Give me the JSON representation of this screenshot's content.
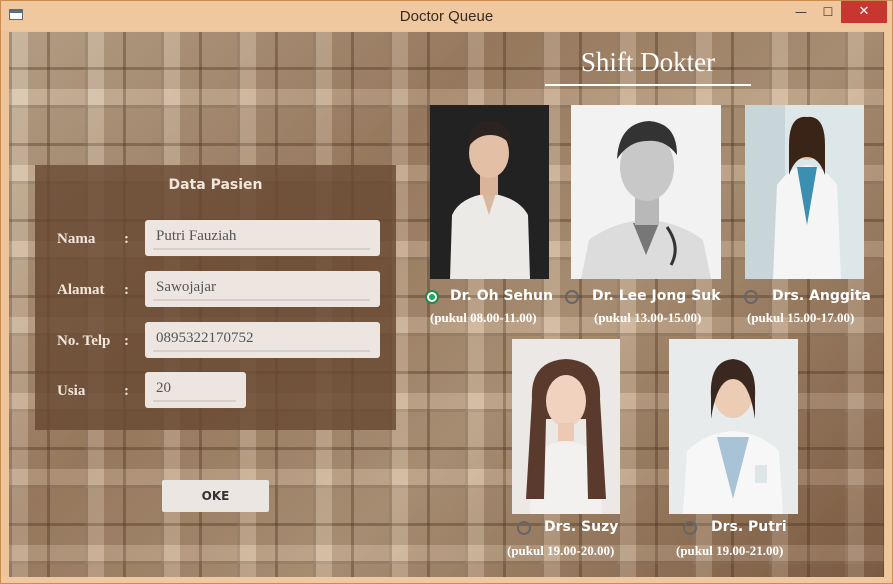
{
  "window": {
    "title": "Doctor Queue",
    "minimize_glyph": "—",
    "maximize_glyph": "☐",
    "close_glyph": "✕"
  },
  "form": {
    "title": "Data Pasien",
    "fields": [
      {
        "label": "Nama",
        "colon": ":",
        "value": "Putri Fauziah"
      },
      {
        "label": "Alamat",
        "colon": ":",
        "value": "Sawojajar"
      },
      {
        "label": "No. Telp",
        "colon": ":",
        "value": "0895322170752"
      },
      {
        "label": "Usia",
        "colon": ":",
        "value": "20"
      }
    ],
    "ok_label": "OKE"
  },
  "shift": {
    "title": "Shift Dokter",
    "doctors": [
      {
        "name": "Dr. Oh Sehun",
        "time": "(pukul 08.00-11.00)",
        "selected": true
      },
      {
        "name": "Dr. Lee Jong Suk",
        "time": "(pukul 13.00-15.00)",
        "selected": false
      },
      {
        "name": "Drs. Anggita",
        "time": "(pukul 15.00-17.00)",
        "selected": false
      },
      {
        "name": "Drs. Suzy",
        "time": "(pukul 19.00-20.00)",
        "selected": false
      },
      {
        "name": "Drs. Putri",
        "time": "(pukul 19.00-21.00)",
        "selected": false
      }
    ]
  },
  "colors": {
    "selected_radio": "#25a65a",
    "panel_bg": "#684832",
    "titlebar_bg": "#f0c89f",
    "close_button": "#c7372f"
  }
}
